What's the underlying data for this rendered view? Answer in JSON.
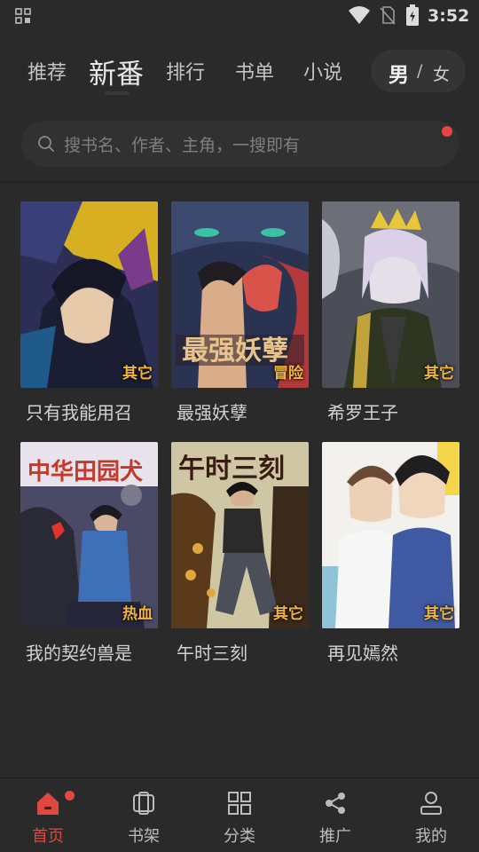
{
  "status_bar": {
    "time": "3:52",
    "icons": [
      "grid-icon",
      "wifi-icon",
      "no-sim-icon",
      "battery-icon"
    ]
  },
  "tabs": {
    "items": [
      {
        "label": "推荐",
        "active": false
      },
      {
        "label": "新番",
        "active": true
      },
      {
        "label": "排行",
        "active": false
      },
      {
        "label": "书单",
        "active": false
      },
      {
        "label": "小说",
        "active": false
      }
    ],
    "gender": {
      "male": "男",
      "separator": "/",
      "female": "女",
      "selected": "男"
    }
  },
  "search": {
    "placeholder": "搜书名、作者、主角，一搜即有",
    "has_notification": true
  },
  "comics": [
    {
      "title": "只有我能用召",
      "tag": "其它"
    },
    {
      "title": "最强妖孽",
      "tag": "冒险"
    },
    {
      "title": "希罗王子",
      "tag": "其它"
    },
    {
      "title": "我的契约兽是",
      "tag": "热血"
    },
    {
      "title": "午时三刻",
      "tag": "其它"
    },
    {
      "title": "再见嫣然",
      "tag": "其它"
    }
  ],
  "bottom_nav": {
    "items": [
      {
        "label": "首页",
        "icon": "home-icon",
        "active": true,
        "badge": true
      },
      {
        "label": "书架",
        "icon": "bookshelf-icon",
        "active": false,
        "badge": false
      },
      {
        "label": "分类",
        "icon": "category-grid-icon",
        "active": false,
        "badge": false
      },
      {
        "label": "推广",
        "icon": "share-icon",
        "active": false,
        "badge": false
      },
      {
        "label": "我的",
        "icon": "profile-icon",
        "active": false,
        "badge": false
      }
    ]
  },
  "colors": {
    "background": "#2b2a2b",
    "accent": "#e0473f",
    "tag": "#f2b63a"
  }
}
